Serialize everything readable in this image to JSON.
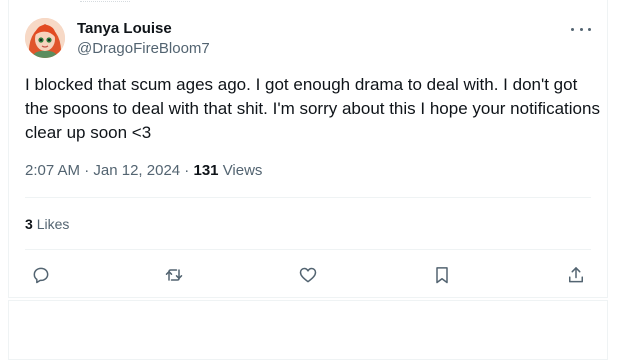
{
  "tweet": {
    "author_name": "Tanya Louise",
    "author_handle": "@DragoFireBloom7",
    "text": "I blocked that scum ages ago. I got enough drama to deal with. I don't got the spoons to deal with that shit. I'm sorry about this I hope your notifications clear up soon <3",
    "time": "2:07 AM",
    "date": "Jan 12, 2024",
    "separator": " · ",
    "views_count": "131",
    "views_label": "Views",
    "likes_count": "3",
    "likes_label": "Likes"
  },
  "icons": {
    "more": "more-icon",
    "reply": "reply-icon",
    "retweet": "retweet-icon",
    "like": "heart-icon",
    "bookmark": "bookmark-icon",
    "share": "share-icon"
  },
  "colors": {
    "text_primary": "#0f1419",
    "text_secondary": "#536471",
    "divider": "#eff3f4"
  }
}
